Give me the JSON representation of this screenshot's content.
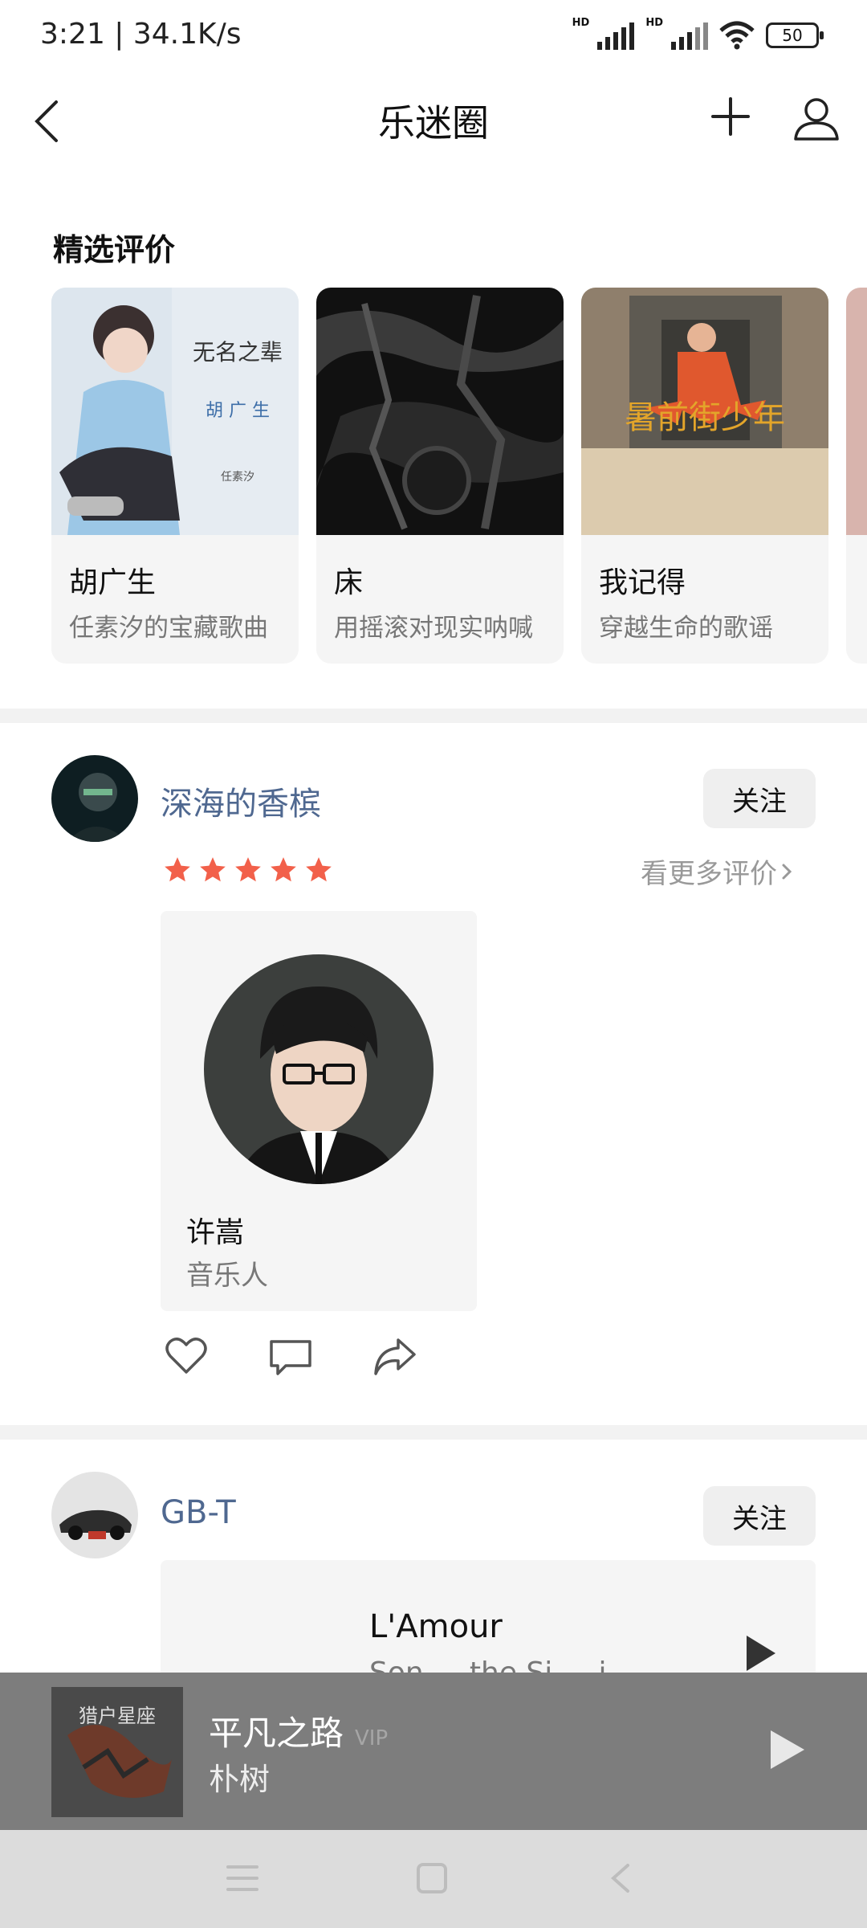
{
  "status_bar": {
    "time": "3:21 | 34.1K/s",
    "battery": "50",
    "hd_badges": [
      "HD",
      "HD"
    ]
  },
  "header": {
    "title": "乐迷圈"
  },
  "featured": {
    "section_title": "精选评价",
    "cards": [
      {
        "title": "胡广生",
        "subtitle": "任素汐的宝藏歌曲"
      },
      {
        "title": "床",
        "subtitle": "用摇滚对现实呐喊"
      },
      {
        "title": "我记得",
        "subtitle": "穿越生命的歌谣"
      }
    ]
  },
  "posts": [
    {
      "username": "深海的香槟",
      "follow_label": "关注",
      "rating": 5,
      "more_label": "看更多评价",
      "artist": {
        "name": "许嵩",
        "role": "音乐人"
      }
    },
    {
      "username": "GB-T",
      "follow_label": "关注",
      "song": {
        "title": "L'Amour",
        "subtitle": "Son ... the Si ... i"
      }
    }
  ],
  "player": {
    "title": "平凡之路",
    "vip": "VIP",
    "artist": "朴树"
  },
  "colors": {
    "username": "#4f6890",
    "star": "#f2604a",
    "player_bg": "#7d7d7d"
  }
}
